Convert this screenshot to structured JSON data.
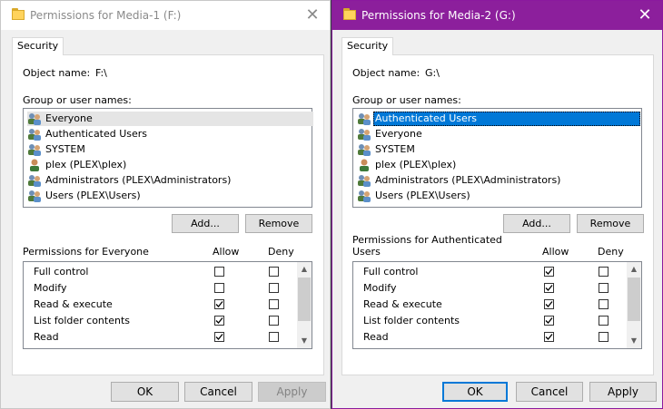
{
  "dialogs": [
    {
      "title": "Permissions for Media-1 (F:)",
      "tab": "Security",
      "object_label": "Object name:",
      "object_value": "F:\\",
      "group_label": "Group or user names:",
      "users": [
        "Everyone",
        "Authenticated Users",
        "SYSTEM",
        "plex (PLEX\\plex)",
        "Administrators (PLEX\\Administrators)",
        "Users (PLEX\\Users)"
      ],
      "add_label": "Add...",
      "remove_label": "Remove",
      "perm_label": "Permissions for Everyone",
      "allow_header": "Allow",
      "deny_header": "Deny",
      "permissions": [
        {
          "name": "Full control",
          "allow": false,
          "deny": false
        },
        {
          "name": "Modify",
          "allow": false,
          "deny": false
        },
        {
          "name": "Read & execute",
          "allow": true,
          "deny": false
        },
        {
          "name": "List folder contents",
          "allow": true,
          "deny": false
        },
        {
          "name": "Read",
          "allow": true,
          "deny": false
        }
      ],
      "ok_label": "OK",
      "cancel_label": "Cancel",
      "apply_label": "Apply"
    },
    {
      "title": "Permissions for Media-2 (G:)",
      "tab": "Security",
      "object_label": "Object name:",
      "object_value": "G:\\",
      "group_label": "Group or user names:",
      "users": [
        "Authenticated Users",
        "Everyone",
        "SYSTEM",
        "plex (PLEX\\plex)",
        "Administrators (PLEX\\Administrators)",
        "Users (PLEX\\Users)"
      ],
      "add_label": "Add...",
      "remove_label": "Remove",
      "perm_label_line1": "Permissions for Authenticated",
      "perm_label_line2": "Users",
      "allow_header": "Allow",
      "deny_header": "Deny",
      "permissions": [
        {
          "name": "Full control",
          "allow": true,
          "deny": false
        },
        {
          "name": "Modify",
          "allow": true,
          "deny": false
        },
        {
          "name": "Read & execute",
          "allow": true,
          "deny": false
        },
        {
          "name": "List folder contents",
          "allow": true,
          "deny": false
        },
        {
          "name": "Read",
          "allow": true,
          "deny": false
        }
      ],
      "ok_label": "OK",
      "cancel_label": "Cancel",
      "apply_label": "Apply"
    }
  ],
  "icons": {
    "close": "close-icon",
    "folder": "folder-icon",
    "group": "user-group-icon",
    "user": "user-icon",
    "scroll_up": "scroll-up-icon",
    "scroll_down": "scroll-down-icon",
    "check": "checkmark-icon"
  },
  "colors": {
    "accent_title": "#8c1f9c",
    "selection": "#0078d7"
  }
}
